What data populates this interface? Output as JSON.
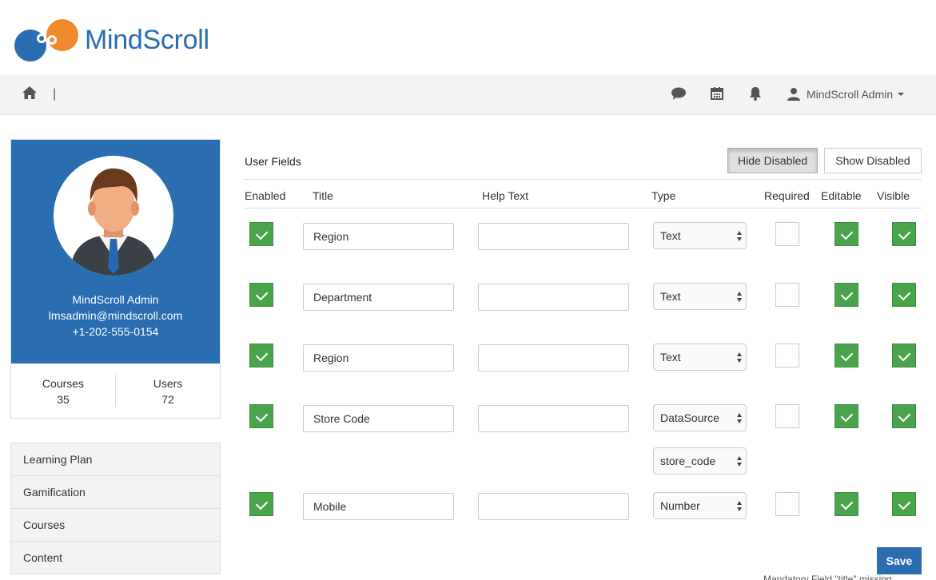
{
  "app": {
    "logo_text": "MindScroll"
  },
  "navbar": {
    "separator": "|",
    "user_label": "MindScroll Admin",
    "icons": [
      "home-icon",
      "chat-icon",
      "calendar-icon",
      "bell-icon",
      "user-icon"
    ]
  },
  "profile": {
    "name": "MindScroll Admin",
    "email": "lmsadmin@mindscroll.com",
    "phone": "+1-202-555-0154",
    "stats": [
      {
        "label": "Courses",
        "value": "35"
      },
      {
        "label": "Users",
        "value": "72"
      }
    ]
  },
  "menu": [
    "Learning Plan",
    "Gamification",
    "Courses",
    "Content"
  ],
  "main": {
    "section_title": "User Fields",
    "hide_disabled": "Hide Disabled",
    "show_disabled": "Show Disabled",
    "columns": [
      "Enabled",
      "Title",
      "Help Text",
      "Type",
      "Required",
      "Editable",
      "Visible"
    ],
    "rows": [
      {
        "enabled": true,
        "title": "Region",
        "help": "",
        "type": "Text",
        "required": false,
        "editable": true,
        "visible": true
      },
      {
        "enabled": true,
        "title": "Department",
        "help": "",
        "type": "Text",
        "required": false,
        "editable": true,
        "visible": true
      },
      {
        "enabled": true,
        "title": "Region",
        "help": "",
        "type": "Text",
        "required": false,
        "editable": true,
        "visible": true
      },
      {
        "enabled": true,
        "title": "Store Code",
        "help": "",
        "type": "DataSource",
        "datasource": "store_code",
        "required": false,
        "editable": true,
        "visible": true
      },
      {
        "enabled": true,
        "title": "Mobile",
        "help": "",
        "type": "Number",
        "required": false,
        "editable": true,
        "visible": true
      }
    ],
    "save_label": "Save",
    "footnote": "Mandatory Field \"title\" missing"
  },
  "colors": {
    "brand_blue": "#2a6db0",
    "brand_orange": "#f0892b",
    "check_green": "#4ba34e"
  }
}
